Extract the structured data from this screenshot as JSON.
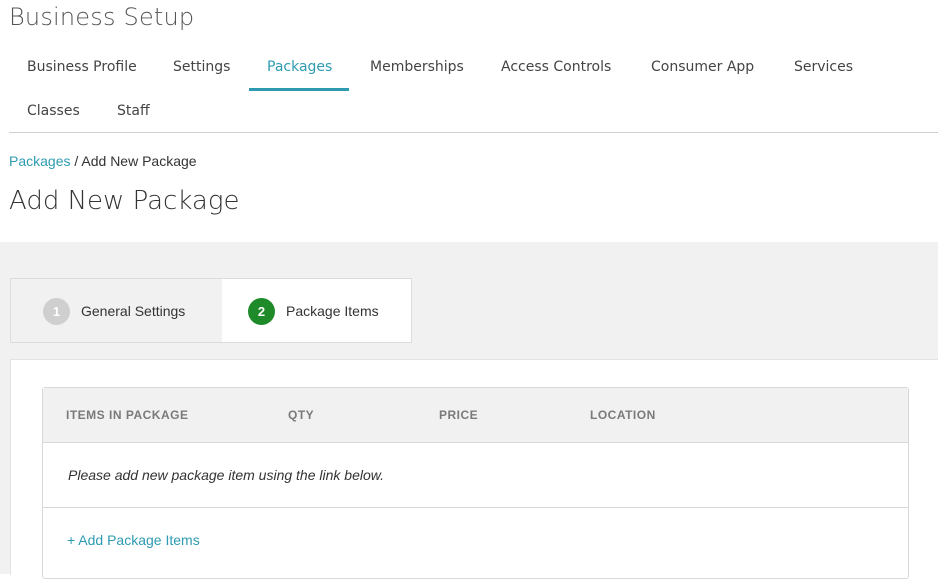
{
  "header": {
    "title": "Business Setup"
  },
  "tabs": [
    {
      "label": "Business Profile"
    },
    {
      "label": "Settings"
    },
    {
      "label": "Packages"
    },
    {
      "label": "Memberships"
    },
    {
      "label": "Access Controls"
    },
    {
      "label": "Consumer App"
    },
    {
      "label": "Services"
    },
    {
      "label": "Classes"
    },
    {
      "label": "Staff"
    }
  ],
  "active_tab": "Packages",
  "breadcrumb": {
    "link": "Packages",
    "separator": " / ",
    "current": "Add New Package"
  },
  "page_title": "Add New Package",
  "stepper": {
    "steps": [
      {
        "number": "1",
        "label": "General Settings",
        "state": "inactive"
      },
      {
        "number": "2",
        "label": "Package Items",
        "state": "active"
      }
    ]
  },
  "table": {
    "columns": [
      "ITEMS IN PACKAGE",
      "QTY",
      "PRICE",
      "LOCATION"
    ],
    "empty_message": "Please add new package item using the link below.",
    "add_link": "+ Add Package Items"
  },
  "colors": {
    "accent": "#2e9bb0",
    "step_active": "#1f8a2a",
    "step_inactive": "#cfcfcf"
  }
}
